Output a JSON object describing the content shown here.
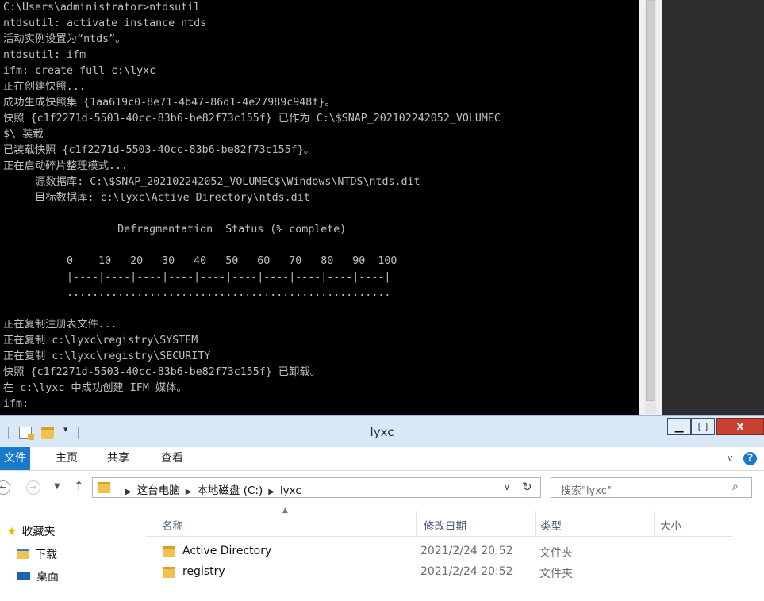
{
  "console": {
    "lines": [
      "C:\\Users\\administrator>ntdsutil",
      "ntdsutil: activate instance ntds",
      "活动实例设置为“ntds”。",
      "ntdsutil: ifm",
      "ifm: create full c:\\lyxc",
      "正在创建快照...",
      "成功生成快照集 {1aa619c0-8e71-4b47-86d1-4e27989c948f}。",
      "快照 {c1f2271d-5503-40cc-83b6-be82f73c155f} 已作为 C:\\$SNAP_202102242052_VOLUMEC",
      "$\\ 装载",
      "已装载快照 {c1f2271d-5503-40cc-83b6-be82f73c155f}。",
      "正在启动碎片整理模式...",
      "     源数据库: C:\\$SNAP_202102242052_VOLUMEC$\\Windows\\NTDS\\ntds.dit",
      "     目标数据库: c:\\lyxc\\Active Directory\\ntds.dit",
      "",
      "                  Defragmentation  Status (% complete)",
      "",
      "          0    10   20   30   40   50   60   70   80   90  100",
      "          |----|----|----|----|----|----|----|----|----|----|",
      "          ...................................................",
      "",
      "正在复制注册表文件...",
      "正在复制 c:\\lyxc\\registry\\SYSTEM",
      "正在复制 c:\\lyxc\\registry\\SECURITY",
      "快照 {c1f2271d-5503-40cc-83b6-be82f73c155f} 已卸载。",
      "在 c:\\lyxc 中成功创建 IFM 媒体。",
      "ifm:"
    ]
  },
  "explorer": {
    "title": "lyxc",
    "window_buttons": {
      "minimize": "▁",
      "maximize": "▢",
      "close": "x"
    },
    "ribbon_tabs": {
      "file": "文件",
      "home": "主页",
      "share": "共享",
      "view": "查看"
    },
    "address": {
      "crumbs": [
        "这台电脑",
        "本地磁盘 (C:)",
        "lyxc"
      ]
    },
    "search_placeholder": "搜索\"lyxc\"",
    "nav_pane": {
      "favorites": "收藏夹",
      "downloads": "下载",
      "desktop": "桌面"
    },
    "columns": {
      "name": "名称",
      "modified": "修改日期",
      "type": "类型",
      "size": "大小"
    },
    "files": [
      {
        "name": "Active Directory",
        "modified": "2021/2/24 20:52",
        "type": "文件夹"
      },
      {
        "name": "registry",
        "modified": "2021/2/24 20:52",
        "type": "文件夹"
      }
    ]
  },
  "icons": {
    "back": "arrow-left-icon",
    "forward": "arrow-right-icon",
    "up": "arrow-up-icon",
    "refresh": "refresh-icon",
    "search": "search-icon",
    "help": "help-icon"
  },
  "colors": {
    "console_bg": "#000000",
    "console_text": "#c0c0c0",
    "titlebar": "#d9e8f7",
    "file_tab": "#1979ca",
    "close_button": "#c84031",
    "folder": "#f1c24f"
  }
}
